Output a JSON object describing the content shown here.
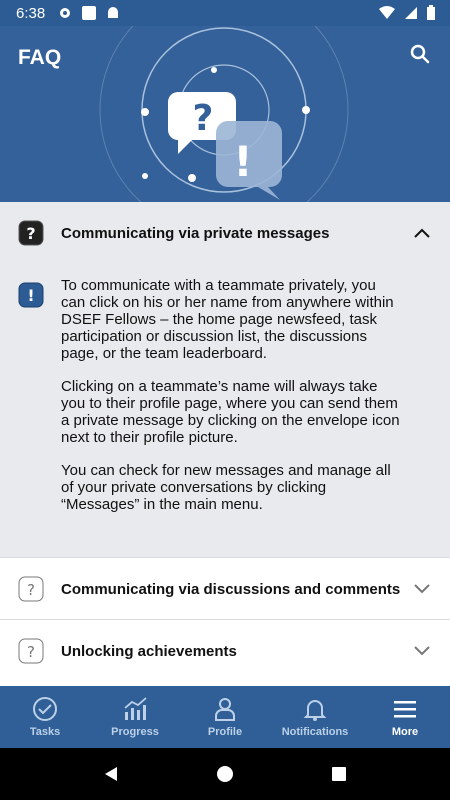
{
  "status": {
    "time": "6:38"
  },
  "header": {
    "title": "FAQ"
  },
  "faq": [
    {
      "question": "Communicating via private messages",
      "expanded": true,
      "answer": [
        "To communicate with a teammate privately, you can click on his or her name from anywhere within DSEF Fellows – the home page newsfeed, task participation or discussion list, the discussions page, or the team leaderboard.",
        "Clicking on a teammate’s name will always take you to their profile page, where you can send them a private message by clicking on the envelope icon next to their profile picture.",
        "You can check for new messages and manage all of your private conversations by clicking “Messages” in the main menu."
      ]
    },
    {
      "question": "Communicating via discussions and comments",
      "expanded": false
    },
    {
      "question": "Unlocking achievements",
      "expanded": false
    }
  ],
  "nav": {
    "tabs": [
      {
        "label": "Tasks",
        "icon": "check-circle-icon"
      },
      {
        "label": "Progress",
        "icon": "chart-icon"
      },
      {
        "label": "Profile",
        "icon": "person-icon"
      },
      {
        "label": "Notifications",
        "icon": "bell-icon"
      },
      {
        "label": "More",
        "icon": "menu-icon",
        "active": true
      }
    ]
  },
  "colors": {
    "header": "#346199",
    "nav": "#2f5f96",
    "expandedBg": "#e8eaee",
    "accentIcon": "#2c5c93"
  }
}
